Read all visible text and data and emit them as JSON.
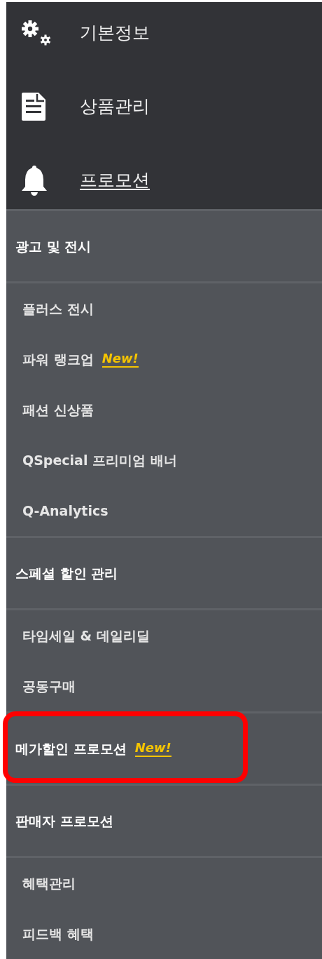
{
  "top_menu": [
    {
      "label": "기본정보",
      "selected": false
    },
    {
      "label": "상품관리",
      "selected": false
    },
    {
      "label": "프로모션",
      "selected": true
    }
  ],
  "sections": [
    {
      "title": "광고 및 전시",
      "items": [
        {
          "label": "플러스 전시"
        },
        {
          "label": "파워 랭크업",
          "badge": "New!"
        },
        {
          "label": "패션 신상품"
        },
        {
          "label": "QSpecial 프리미엄 배너"
        },
        {
          "label": "Q-Analytics"
        }
      ]
    },
    {
      "title": "스페셜 할인 관리",
      "items": [
        {
          "label": "타임세일 & 데일리딜"
        },
        {
          "label": "공동구매"
        }
      ]
    },
    {
      "title": "메가할인 프로모션",
      "badge": "New!",
      "highlighted": true
    },
    {
      "title": "판매자 프로모션",
      "items": [
        {
          "label": "혜택관리"
        },
        {
          "label": "피드백 혜택"
        }
      ]
    }
  ]
}
